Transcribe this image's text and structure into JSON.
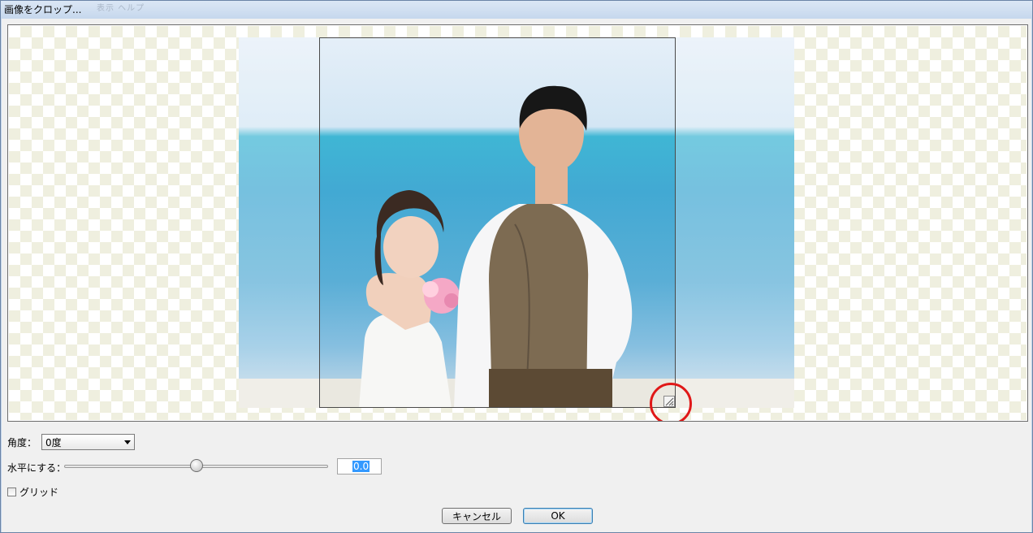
{
  "window": {
    "title": "画像をクロップ...",
    "title_ghost": "表示 ヘルプ"
  },
  "controls": {
    "angle_label": "角度：",
    "angle_value": "0度",
    "level_label": "水平にする：",
    "level_slider_fraction": 0.5,
    "level_value": "0.0",
    "grid_label": "グリッド",
    "grid_checked": false
  },
  "buttons": {
    "cancel": "キャンセル",
    "ok": "OK"
  },
  "colors": {
    "highlight": "#e01818",
    "selection": "#3399ff"
  }
}
